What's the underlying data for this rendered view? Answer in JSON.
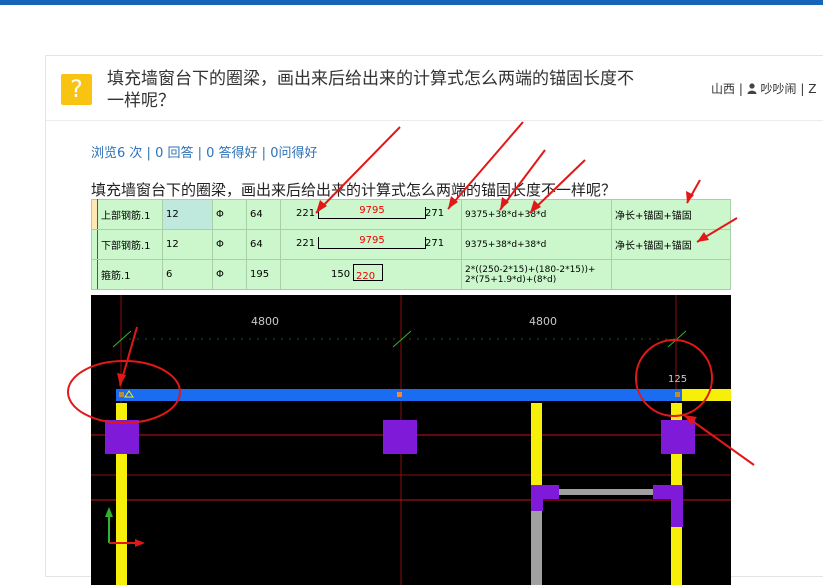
{
  "question": {
    "icon": "question-mark-icon",
    "icon_glyph": "?",
    "title_line1": "填充墙窗台下的圈梁，画出来后给出来的计算式怎么两端的锚固长度不",
    "title_line2": "一样呢？",
    "location": "山西",
    "separator": "|",
    "username": "吵吵闹",
    "meta_tail": "| Z"
  },
  "stats": {
    "views": "浏览6 次",
    "answers": "0 回答",
    "good_answers": "0 答得好",
    "good_received": "0问得好",
    "sep": " | "
  },
  "body_title": "填充墙窗台下的圈梁，画出来后给出来的计算式怎么两端的锚固长度不一样呢？",
  "rebar_table": {
    "rows": [
      {
        "name": "上部钢筋.1",
        "diameter": "12",
        "grade": "Φ",
        "figure_no": "64",
        "left": "221",
        "length": "9795",
        "right": "271",
        "formula": "9375+38*d+38*d",
        "description": "净长+锚固+锚固"
      },
      {
        "name": "下部钢筋.1",
        "diameter": "12",
        "grade": "Φ",
        "figure_no": "64",
        "left": "221",
        "length": "9795",
        "right": "271",
        "formula": "9375+38*d+38*d",
        "description": "净长+锚固+锚固"
      },
      {
        "name": "箍筋.1",
        "diameter": "6",
        "grade": "Φ",
        "figure_no": "195",
        "left": "150",
        "length": "220",
        "right": "",
        "formula_line1": "2*((250-2*15)+(180-2*15))+",
        "formula_line2": "2*(75+1.9*d)+(8*d)",
        "description": ""
      }
    ]
  },
  "cad": {
    "dim_left": "4800",
    "dim_right": "4800",
    "dim_small": "125",
    "colors": {
      "background": "#000000",
      "beam": "#1a6cf0",
      "column": "#7f1ad8",
      "wall": "#f5ef0a",
      "axis": "#c61212",
      "annotation": "#e21818"
    }
  }
}
